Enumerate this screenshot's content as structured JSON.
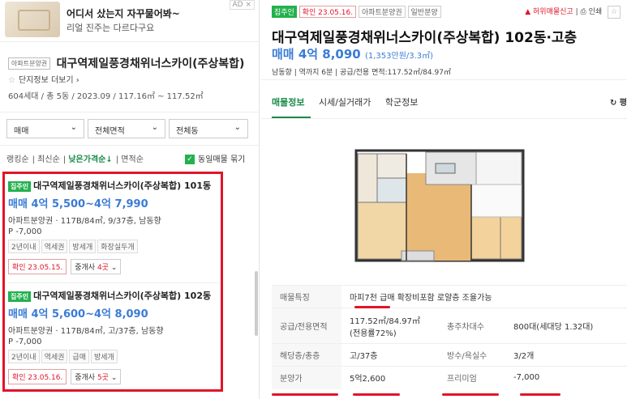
{
  "ad": {
    "tag": "AD ×",
    "title": "어디서 샀는지 자꾸물어봐~",
    "subtitle": "리얼 진주는 다르다구요"
  },
  "complex": {
    "badge": "아파트분양권",
    "name": "대구역제일풍경채위너스카이(주상복합)",
    "more_link": "단지정보 더보기",
    "info": "604세대 / 총 5동 / 2023.09 / 117.16㎡ ~ 117.52㎡"
  },
  "filters": {
    "trade": "매매",
    "area": "전체면적",
    "dong": "전체동"
  },
  "sort": {
    "options": [
      "랭킹순",
      "최신순",
      "낮은가격순↓",
      "면적순"
    ],
    "active_index": 2,
    "same_listing_label": "동일매물 묶기",
    "same_listing_checked": true
  },
  "listings": [
    {
      "tag": "집주인",
      "title": "대구역제일풍경채위너스카이(주상복합) 101동",
      "price": "매매 4억 5,500~4억 7,990",
      "spec": "아파트분양권 · 117B/84㎡, 9/37층, 남동향",
      "premium": "P -7,000",
      "tags": [
        "2년이내",
        "역세권",
        "방세개",
        "화장실두개"
      ],
      "confirm": "확인 23.05.15.",
      "agents_prefix": "중개사 ",
      "agents_count": "4곳"
    },
    {
      "tag": "집주인",
      "title": "대구역제일풍경채위너스카이(주상복합) 102동",
      "price": "매매 4억 5,600~4억 8,090",
      "spec": "아파트분양권 · 117B/84㎡, 고/37층, 남동향",
      "premium": "P -7,000",
      "tags": [
        "2년이내",
        "역세권",
        "급매",
        "방세개"
      ],
      "confirm": "확인 23.05.16.",
      "agents_prefix": "중개사 ",
      "agents_count": "5곳"
    }
  ],
  "detail": {
    "badge_owner": "집주인",
    "badge_confirm": "확인 23.05.16.",
    "badge_type": "아파트분양권",
    "badge_kind": "일반분양",
    "report": "허위매물신고",
    "print": "인쇄",
    "title": "대구역제일풍경채위너스카이(주상복합) 102동·고층",
    "price": "매매 4억 8,090",
    "price_sub": "(1,353만원/3.3㎡)",
    "desc": "남동향 | 역까지 6분 | 공급/전용 면적:117.52㎡/84.97㎡",
    "tabs": [
      "매물정보",
      "시세/실거래가",
      "학군정보"
    ],
    "refresh": "↻ 평",
    "table": {
      "feature_label": "매물특징",
      "feature_value": "마피7천 급매 확장비포함 로얄층 조율가능",
      "area_label": "공급/전용면적",
      "area_value": "117.52㎡/84.97㎡(전용률72%)",
      "parking_label": "총주차대수",
      "parking_value": "800대(세대당 1.32대)",
      "floor_label": "해당층/총층",
      "floor_value": "고/37층",
      "rooms_label": "방수/욕실수",
      "rooms_value": "3/2개",
      "sale_label": "분양가",
      "sale_value": "5억2,600",
      "premium_label": "프리미엄",
      "premium_value": "-7,000"
    }
  },
  "colors": {
    "accent_green": "#1a8a4a",
    "price_blue": "#3a7bd5",
    "highlight_red": "#e0152a"
  }
}
